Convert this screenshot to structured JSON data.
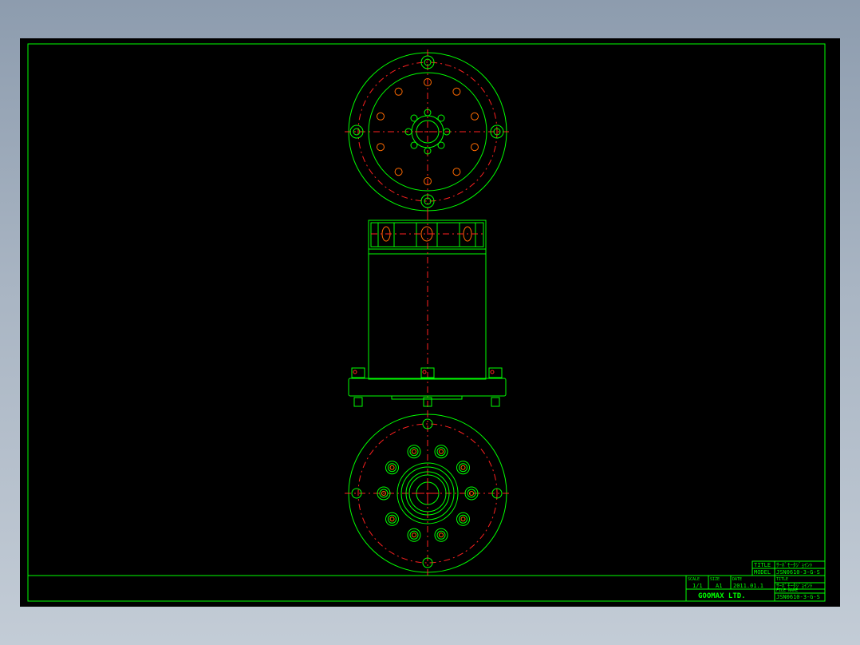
{
  "colors": {
    "background": "#000000",
    "geometry": "#00ff00",
    "centerlines": "#ff2020",
    "holes": "#ff6a00"
  },
  "drawing": {
    "views": [
      "top-view",
      "side-view",
      "bottom-view"
    ]
  },
  "title_block": {
    "title_label": "TITLE",
    "title_value": "ｻｰﾎﾞﾓｰﾀｼﾞｮｲﾝﾄ",
    "model_label": "MODEL",
    "model_value": "JSN0610-3-G-S",
    "scale_label": "SCALE",
    "scale_value": "1/1",
    "size_label": "SIZE",
    "size_value": "A1",
    "date_label": "DATE",
    "date_value": "2011.01.1",
    "sub_title_label": "TITLE",
    "sub_title_value": "ｻｰﾎﾞﾓｰﾀｼﾞｮｲﾝﾄ",
    "file_label": "FILE NAME",
    "file_value": "JSN0610-3-G-S",
    "company": "GOOMAX LTD."
  }
}
